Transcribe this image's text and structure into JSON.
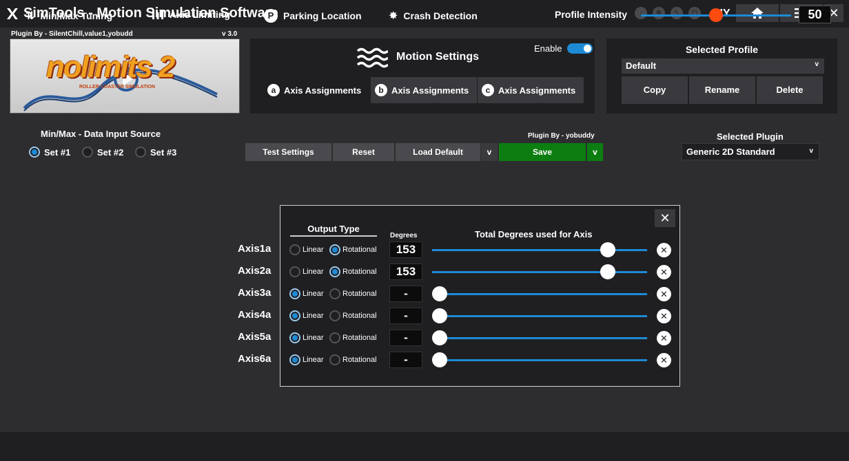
{
  "titlebar": {
    "title": "SimTools - Motion Simulation Software",
    "mode": "DIY",
    "icons": [
      "download-icon",
      "settings-icon",
      "edit-icon",
      "power-icon"
    ]
  },
  "plugin_banner": {
    "author": "Plugin By - SilentChill,value1,yobudd",
    "version": "v 3.0",
    "logo_text": "nolimits 2",
    "logo_subtext": "ROLLER COASTER SIMULATION"
  },
  "motion_settings": {
    "title": "Motion Settings",
    "enable_label": "Enable",
    "enabled": true,
    "tabs": [
      {
        "badge": "a",
        "label": "Axis Assignments",
        "active": true
      },
      {
        "badge": "b",
        "label": "Axis Assignments",
        "active": false
      },
      {
        "badge": "c",
        "label": "Axis Assignments",
        "active": false
      }
    ]
  },
  "profile": {
    "title": "Selected Profile",
    "selected": "Default",
    "chevron": "v",
    "buttons": {
      "copy": "Copy",
      "rename": "Rename",
      "delete": "Delete"
    }
  },
  "data_input": {
    "title": "Min/Max - Data Input Source",
    "sets": [
      {
        "label": "Set #1",
        "selected": true
      },
      {
        "label": "Set #2",
        "selected": false
      },
      {
        "label": "Set #3",
        "selected": false
      }
    ]
  },
  "toolbar": {
    "test_settings": "Test Settings",
    "reset": "Reset",
    "load_default": "Load Default",
    "load_chevron": "v",
    "plugin_by": "Plugin By - yobuddy",
    "save": "Save",
    "save_chevron": "v"
  },
  "plugin_select": {
    "title": "Selected Plugin",
    "selected": "Generic 2D Standard",
    "chevron": "v"
  },
  "axis_dialog": {
    "close": "✕",
    "output_type_title": "Output Type",
    "degrees_title": "Degrees",
    "total_title": "Total Degrees used for Axis",
    "linear_label": "Linear",
    "rotational_label": "Rotational",
    "clear_icon": "✕",
    "axes": [
      {
        "label": "Axis1a",
        "output": "Rotational",
        "degrees": "153",
        "level": 0.84
      },
      {
        "label": "Axis2a",
        "output": "Rotational",
        "degrees": "153",
        "level": 0.84
      },
      {
        "label": "Axis3a",
        "output": "Linear",
        "degrees": "-",
        "level": 0
      },
      {
        "label": "Axis4a",
        "output": "Linear",
        "degrees": "-",
        "level": 0
      },
      {
        "label": "Axis5a",
        "output": "Linear",
        "degrees": "-",
        "level": 0
      },
      {
        "label": "Axis6a",
        "output": "Linear",
        "degrees": "-",
        "level": 0
      }
    ]
  },
  "bottombar": {
    "items": [
      {
        "icon": "up-down-arrows-icon",
        "label": "Min/Max Tuning"
      },
      {
        "icon": "axis-bars-icon",
        "label": "Axis Limiting"
      },
      {
        "icon": "parking-icon",
        "label": "Parking Location"
      },
      {
        "icon": "crash-burst-icon",
        "label": "Crash Detection"
      }
    ],
    "intensity_label": "Profile Intensity",
    "intensity_value": "50",
    "intensity_level": 0.5
  },
  "colors": {
    "accent": "#1e8ad6",
    "save_green": "#0c7d10",
    "intensity_knob": "#ff4b0f",
    "panel": "#1f1f22",
    "background": "#2d2d30"
  }
}
